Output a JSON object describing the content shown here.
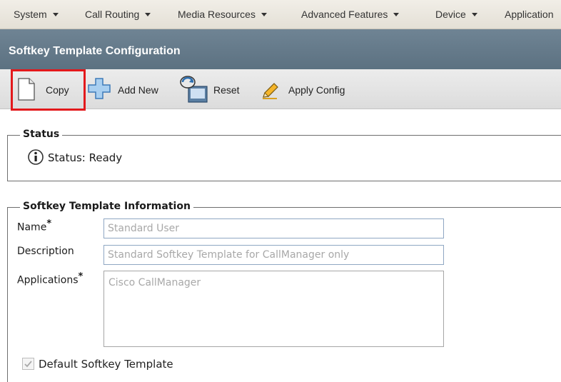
{
  "menu": {
    "items": [
      {
        "label": "System",
        "has_dropdown": true
      },
      {
        "label": "Call Routing",
        "has_dropdown": true
      },
      {
        "label": "Media Resources",
        "has_dropdown": true
      },
      {
        "label": "Advanced Features",
        "has_dropdown": true
      },
      {
        "label": "Device",
        "has_dropdown": true
      },
      {
        "label": "Application",
        "has_dropdown": false
      }
    ]
  },
  "page": {
    "title": "Softkey Template Configuration"
  },
  "toolbar": {
    "copy_label": "Copy",
    "add_new_label": "Add New",
    "reset_label": "Reset",
    "apply_config_label": "Apply Config",
    "highlight_color": "#e3191c"
  },
  "status_section": {
    "legend": "Status",
    "message": "Status: Ready",
    "icon": "info-icon"
  },
  "info_section": {
    "legend": "Softkey Template Information",
    "name": {
      "label": "Name",
      "required_mark": "*",
      "value": "Standard User"
    },
    "description": {
      "label": "Description",
      "value": "Standard Softkey Template for CallManager only"
    },
    "applications": {
      "label": "Applications",
      "required_mark": "*",
      "value": "Cisco CallManager"
    },
    "default_template": {
      "label": "Default Softkey Template",
      "checked": true,
      "disabled": true
    }
  },
  "colors": {
    "title_bar": "#62778a",
    "menu_bar": "#eae6dc",
    "input_border": "#8fa7c3"
  }
}
